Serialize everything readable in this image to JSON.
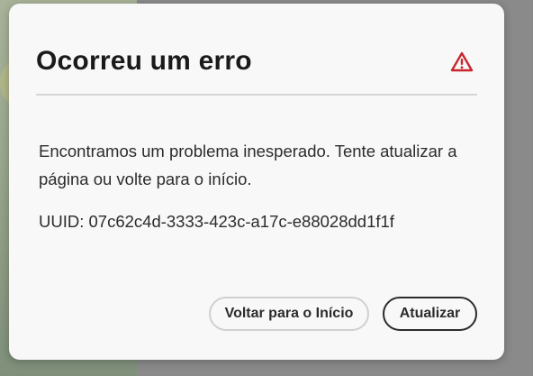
{
  "dialog": {
    "title": "Ocorreu um erro",
    "alert_icon": "alert-triangle-icon",
    "alert_color": "#c9252d",
    "message": "Encontramos um problema inesperado. Tente atualizar a página ou volte para o início.",
    "uuid": "UUID: 07c62c4d-3333-423c-a17c-e88028dd1f1f",
    "buttons": {
      "secondary_label": "Voltar para o Início",
      "primary_label": "Atualizar"
    }
  }
}
